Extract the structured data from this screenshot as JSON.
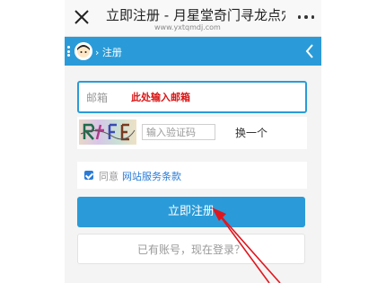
{
  "window": {
    "title": "立即注册 - 月星堂奇门寻龙点穴",
    "url": "www.yxtqmdj.com"
  },
  "navbar": {
    "breadcrumb": "› 注册"
  },
  "form": {
    "email_placeholder": "邮箱",
    "email_hint": "此处输入邮箱",
    "captcha_placeholder": "输入验证码",
    "captcha_refresh": "换一个",
    "agree_prefix": "同意",
    "agree_link": "网站服务条款",
    "register_label": "立即注册",
    "login_label": "已有账号，现在登录？"
  },
  "colors": {
    "accent": "#2a9bd8",
    "hint_red": "#d91414",
    "arrow_red": "#e0161e"
  },
  "icons": {
    "close": "close-icon",
    "more": "more-icon",
    "avatar": "avatar-icon",
    "back": "chevron-left-icon"
  }
}
